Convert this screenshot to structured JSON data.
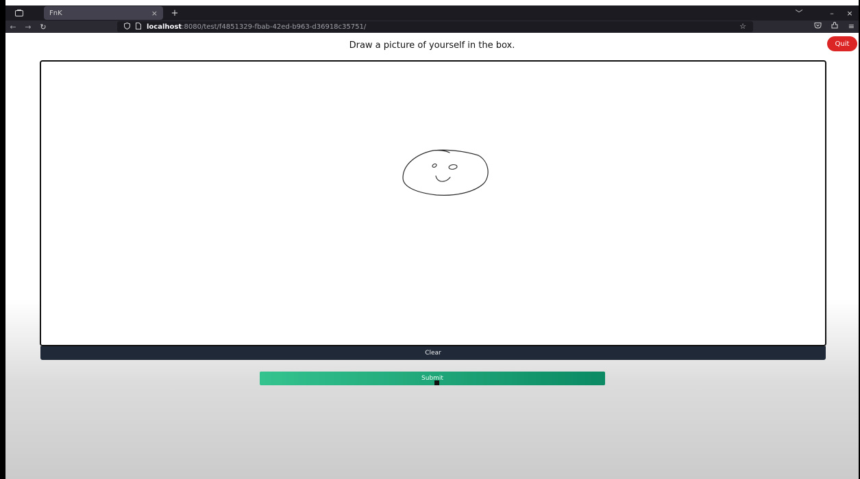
{
  "browser": {
    "tab_title": "FnK",
    "tab_close": "×",
    "new_tab": "+",
    "tab_list_icon": "tab-list-icon",
    "url_host": "localhost",
    "url_rest": ":8080/test/f4851329-fbab-42ed-b963-d36918c35751/",
    "window_controls": {
      "expand": "﹀",
      "minimize": "–",
      "close": "×"
    }
  },
  "page": {
    "prompt": "Draw a picture of yourself in the box.",
    "quit_label": "Quit",
    "clear_label": "Clear",
    "submit_label": "Submit"
  },
  "colors": {
    "quit": "#dc2626",
    "clear": "#1f2937",
    "submit_start": "#34c38f",
    "submit_end": "#0b8a63"
  }
}
